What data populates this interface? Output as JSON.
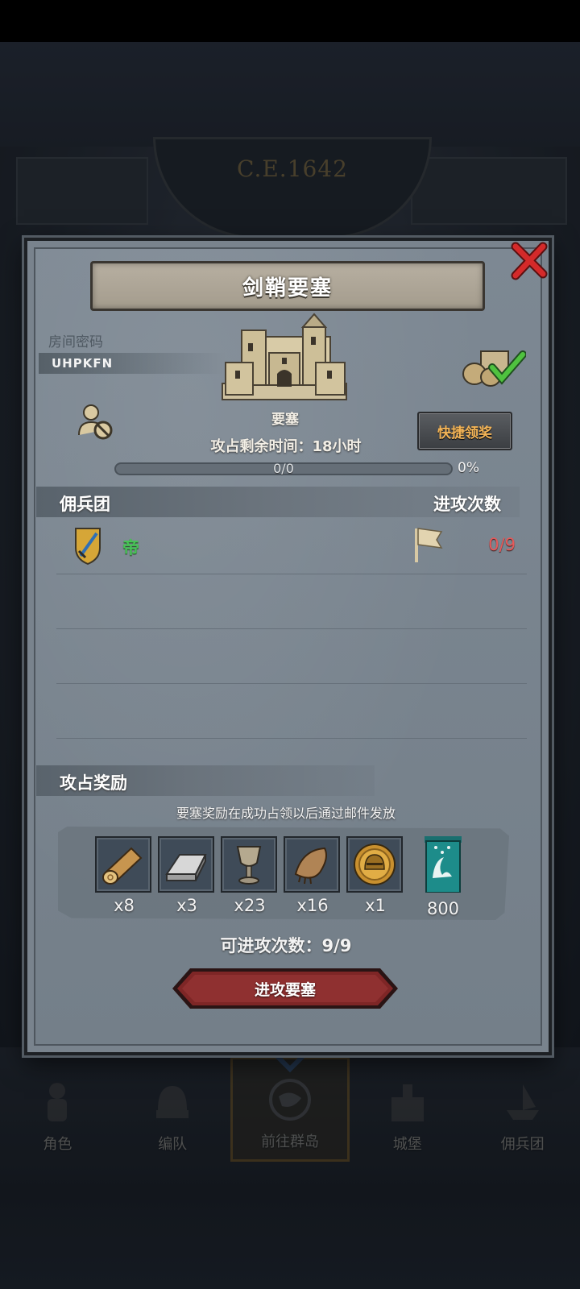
{
  "background": {
    "year": "C.E.1642",
    "nav": [
      {
        "label": "角色",
        "icon": "knight-icon"
      },
      {
        "label": "编队",
        "icon": "helmet-icon"
      },
      {
        "label": "前往群岛",
        "icon": "globe-icon"
      },
      {
        "label": "城堡",
        "icon": "castle-icon"
      },
      {
        "label": "佣兵团",
        "icon": "ship-icon"
      }
    ]
  },
  "dialog": {
    "title": "剑鞘要塞",
    "room_code_label": "房间密码",
    "room_code": "UHPKFN",
    "fortress_label": "要塞",
    "time_remaining": "攻占剩余时间：18小时",
    "quick_claim": "快捷领奖",
    "progress": {
      "text": "0/0",
      "percent_text": "0%",
      "fraction": 0
    },
    "mercenary_header": "佣兵团",
    "attacks_header": "进攻次数",
    "members": [
      {
        "name": "帝",
        "attacks": "0/9"
      }
    ],
    "rewards_header": "攻占奖励",
    "rewards_note": "要塞奖励在成功占领以后通过邮件发放",
    "rewards": [
      {
        "icon": "wood-log-icon",
        "qty": "x8"
      },
      {
        "icon": "iron-ingot-icon",
        "qty": "x3"
      },
      {
        "icon": "goblet-icon",
        "qty": "x23"
      },
      {
        "icon": "fur-pelt-icon",
        "qty": "x16"
      },
      {
        "icon": "gold-helmet-coin-icon",
        "qty": "x1"
      },
      {
        "icon": "guild-banner-icon",
        "qty": "800"
      }
    ],
    "attacks_left": "可进攻次数：9/9",
    "attack_button": "进攻要塞"
  },
  "colors": {
    "panel": "#79838d",
    "accent_orange": "#f3b457",
    "member_green": "#46c455",
    "count_red": "#e55a5a",
    "button_red": "#7e2626"
  }
}
